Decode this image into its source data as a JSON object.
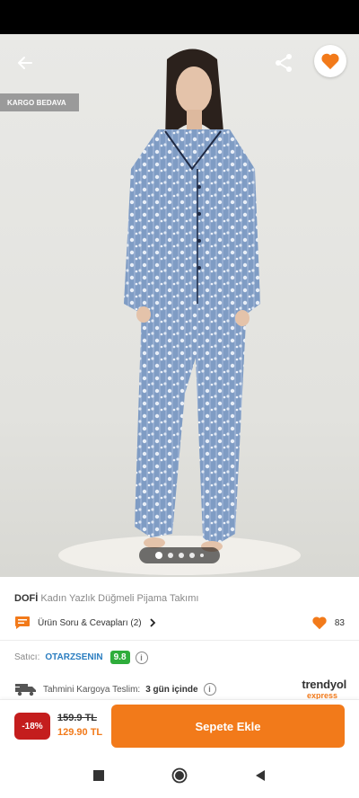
{
  "badge": {
    "kargo": "KARGO BEDAVA"
  },
  "product": {
    "brand": "DOFİ",
    "name": "Kadın Yazlık Düğmeli Pijama Takımı",
    "qa_label": "Ürün Soru & Cevapları (2)",
    "favorite_count": "83"
  },
  "gallery": {
    "image_count": 5,
    "active_index": 0
  },
  "seller": {
    "label": "Satıcı:",
    "name": "OTARZSENIN",
    "rating": "9.8"
  },
  "shipping": {
    "label": "Tahmini Kargoya Teslim:",
    "days": "3 gün içinde",
    "logo_line1": "trendyol",
    "logo_line2": "express"
  },
  "pricing": {
    "discount": "-18%",
    "old_price": "159.9 TL",
    "new_price": "129.90 TL",
    "add_to_cart": "Sepete Ekle"
  },
  "colors": {
    "accent": "#f27a1a",
    "discount_bg": "#c41d1d",
    "rating_bg": "#2ead3b",
    "seller_link": "#2a7dc0"
  },
  "icons": [
    "back-arrow-icon",
    "share-icon",
    "heart-icon",
    "chat-icon",
    "chevron-right-icon",
    "info-icon",
    "truck-icon",
    "nav-square-icon",
    "nav-circle-icon",
    "nav-triangle-icon"
  ]
}
